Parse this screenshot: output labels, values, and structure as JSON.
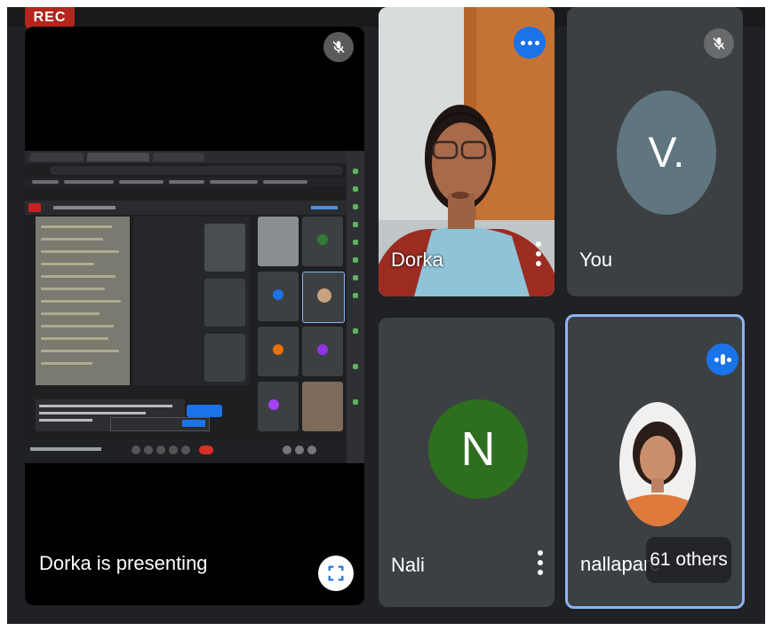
{
  "recording": {
    "label": "REC"
  },
  "presentation": {
    "label": "Dorka  is presenting"
  },
  "participants": [
    {
      "id": "dorka",
      "name": "Dorka",
      "type": "video"
    },
    {
      "id": "you",
      "name": "You",
      "avatar_letter": "V.",
      "avatar_color": "#5f7580"
    },
    {
      "id": "nali",
      "name": "Nali",
      "avatar_letter": "N",
      "avatar_color": "#2e6f1f"
    },
    {
      "id": "nallapare",
      "name": "nallapare",
      "type": "photo",
      "speaking": true
    }
  ],
  "others": {
    "label": "61 others"
  },
  "colors": {
    "stage_bg": "#202124",
    "tile_bg": "#3c4043",
    "accent_blue": "#1a73e8",
    "active_speaker_border": "#8ab4f8",
    "rec_red": "#b3261e"
  },
  "icons": {
    "mic_off": "mic-off-icon",
    "more": "more-options-icon",
    "kebab": "vertical-dots-icon",
    "fullscreen": "fullscreen-icon",
    "speaking": "audio-level-icon"
  }
}
